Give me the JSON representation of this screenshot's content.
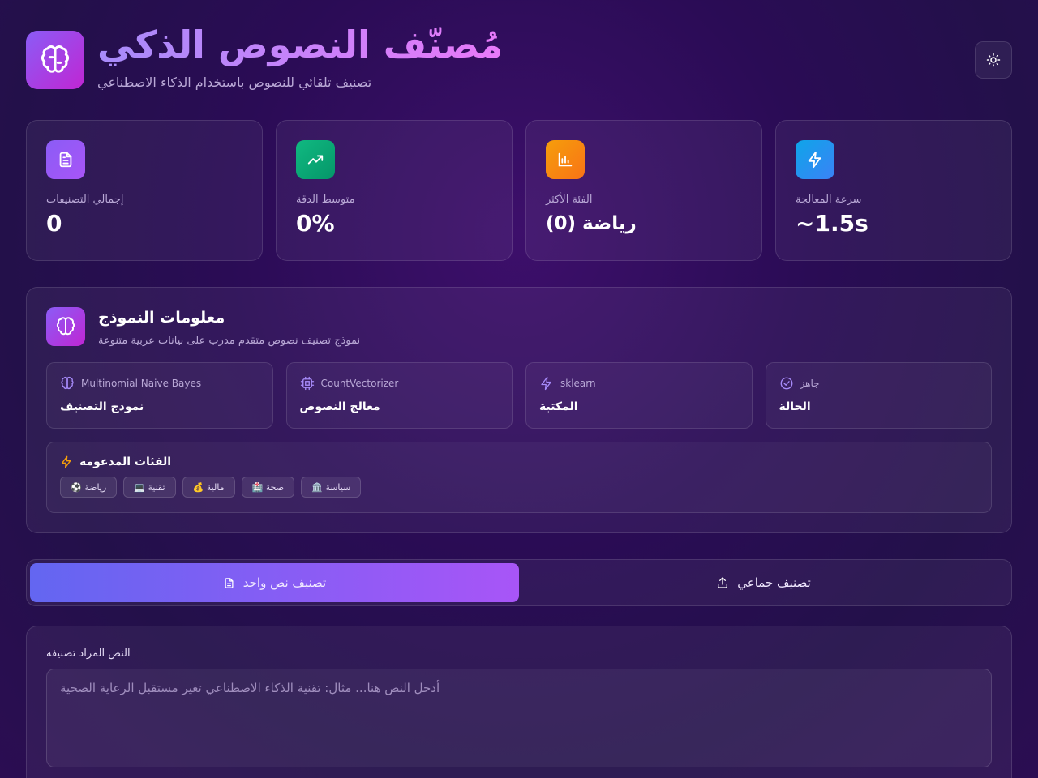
{
  "header": {
    "title": "مُصنّف النصوص الذكي",
    "subtitle": "تصنيف تلقائي للنصوص باستخدام الذكاء الاصطناعي",
    "theme_icon": "sun-icon"
  },
  "stats": [
    {
      "label": "إجمالي التصنيفات",
      "value": "0",
      "icon": "document-icon",
      "color": "#8b5cf6"
    },
    {
      "label": "متوسط الدقة",
      "value": "0%",
      "icon": "trending-up-icon",
      "color": "#10b981"
    },
    {
      "label": "الفئة الأكثر",
      "value": "رياضة (0)",
      "icon": "bar-chart-icon",
      "color": "#f59e0b"
    },
    {
      "label": "سرعة المعالجة",
      "value": "~1.5s",
      "icon": "lightning-icon",
      "color": "#3b82f6"
    }
  ],
  "model": {
    "title": "معلومات النموذج",
    "description": "نموذج تصنيف نصوص متقدم مدرب على بيانات عربية متنوعة",
    "info": [
      {
        "sub": "Multinomial Naive Bayes",
        "main": "نموذج التصنيف",
        "icon": "brain-icon"
      },
      {
        "sub": "CountVectorizer",
        "main": "معالج النصوص",
        "icon": "cpu-icon"
      },
      {
        "sub": "sklearn",
        "main": "المكتبة",
        "icon": "lightning-icon"
      },
      {
        "sub": "جاهز",
        "main": "الحالة",
        "icon": "check-circle-icon"
      }
    ],
    "categories_title": "الفئات المدعومة",
    "categories": [
      "⚽ رياضة",
      "💻 تقنية",
      "💰 مالية",
      "🏥 صحة",
      "🏛️ سياسة"
    ]
  },
  "tabs": [
    {
      "label": "تصنيف نص واحد",
      "active": true
    },
    {
      "label": "تصنيف جماعي",
      "active": false
    }
  ],
  "input": {
    "label": "النص المراد تصنيفه",
    "placeholder": "أدخل النص هنا... مثال: تقنية الذكاء الاصطناعي تغير مستقبل الرعاية الصحية",
    "value": ""
  }
}
